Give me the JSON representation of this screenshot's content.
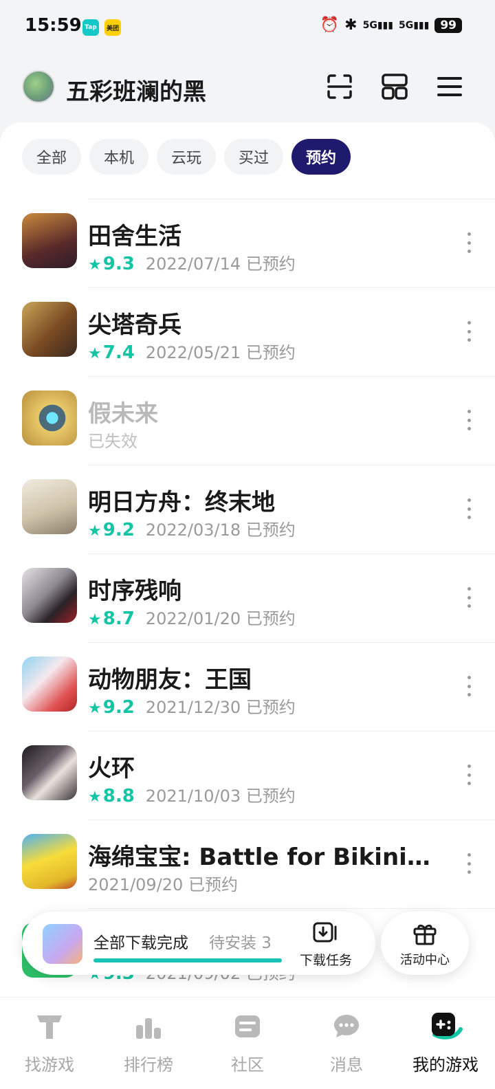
{
  "status_bar": {
    "time": "15:59",
    "badges": [
      "Tap",
      "美团"
    ],
    "network1": "5G",
    "network2": "5G",
    "battery": "99",
    "icons": [
      "alarm-icon",
      "bluetooth-icon",
      "signal-icon",
      "signal-icon",
      "battery-icon"
    ]
  },
  "header": {
    "username": "五彩班澜的黑",
    "actions": [
      "scan-icon",
      "grid-icon",
      "menu-icon"
    ]
  },
  "tabs": [
    {
      "label": "全部",
      "active": false
    },
    {
      "label": "本机",
      "active": false
    },
    {
      "label": "云玩",
      "active": false
    },
    {
      "label": "买过",
      "active": false
    },
    {
      "label": "预约",
      "active": true
    }
  ],
  "games": [
    {
      "title": "田舍生活",
      "rating": "9.3",
      "date": "2022/07/14 已预约",
      "color": "#7a3f2a"
    },
    {
      "title": "尖塔奇兵",
      "rating": "7.4",
      "date": "2022/05/21 已预约",
      "color": "#8a5a2c"
    },
    {
      "title": "假未来",
      "rating": "",
      "date": "已失效",
      "disabled": true,
      "color": "#d8b45c"
    },
    {
      "title": "明日方舟：终末地",
      "rating": "9.2",
      "date": "2022/03/18 已预约",
      "color": "#d9cdb8"
    },
    {
      "title": "时序残响",
      "rating": "8.7",
      "date": "2022/01/20 已预约",
      "color": "#3a3035"
    },
    {
      "title": "动物朋友：王国",
      "rating": "9.2",
      "date": "2021/12/30 已预约",
      "color": "#e07a7a"
    },
    {
      "title": "火环",
      "rating": "8.8",
      "date": "2021/10/03 已预约",
      "color": "#4b4650"
    },
    {
      "title": "海绵宝宝: Battle for Bikini B...",
      "rating": "",
      "date": "2021/09/20 已预约",
      "color": "#f3d23a"
    },
    {
      "title": "",
      "rating": "9.3",
      "date": "2021/09/02 已预约",
      "color": "#2ec26a"
    }
  ],
  "floating": {
    "title": "全部下载完成",
    "sub": "待安装 3",
    "task_label": "下载任务",
    "gift_label": "活动中心"
  },
  "bottom_nav": [
    {
      "label": "找游戏",
      "icon": "find-game-icon",
      "active": false
    },
    {
      "label": "排行榜",
      "icon": "ranking-icon",
      "active": false
    },
    {
      "label": "社区",
      "icon": "community-icon",
      "active": false
    },
    {
      "label": "消息",
      "icon": "message-icon",
      "active": false
    },
    {
      "label": "我的游戏",
      "icon": "my-games-icon",
      "active": true
    }
  ],
  "colors": {
    "accent": "#14c5a5",
    "tab_active": "#1e1a6e"
  }
}
